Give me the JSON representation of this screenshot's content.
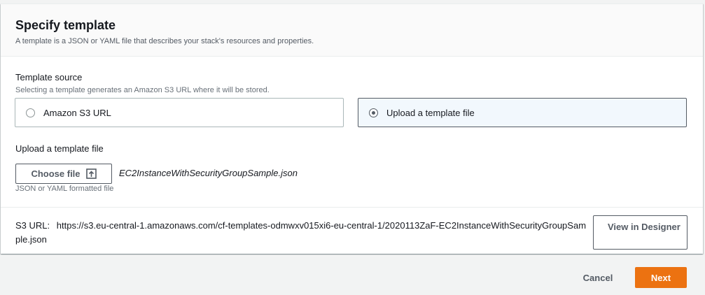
{
  "panel": {
    "title": "Specify template",
    "description": "A template is a JSON or YAML file that describes your stack's resources and properties."
  },
  "template_source": {
    "label": "Template source",
    "description": "Selecting a template generates an Amazon S3 URL where it will be stored.",
    "options": [
      {
        "label": "Amazon S3 URL",
        "selected": false
      },
      {
        "label": "Upload a template file",
        "selected": true
      }
    ]
  },
  "upload": {
    "label": "Upload a template file",
    "choose_button": "Choose file",
    "file_name": "EC2InstanceWithSecurityGroupSample.json",
    "hint": "JSON or YAML formatted file"
  },
  "s3": {
    "label": "S3 URL:",
    "url": "https://s3.eu-central-1.amazonaws.com/cf-templates-odmwxv015xi6-eu-central-1/2020113ZaF-EC2InstanceWithSecurityGroupSample.json",
    "designer_button": "View in Designer"
  },
  "footer": {
    "cancel": "Cancel",
    "next": "Next"
  },
  "colors": {
    "primary": "#ec7211",
    "text": "#16191f",
    "secondary_text": "#545b64",
    "selected_tile": "#f2f8fd"
  },
  "icons": {
    "choose_file": "upload-icon"
  }
}
